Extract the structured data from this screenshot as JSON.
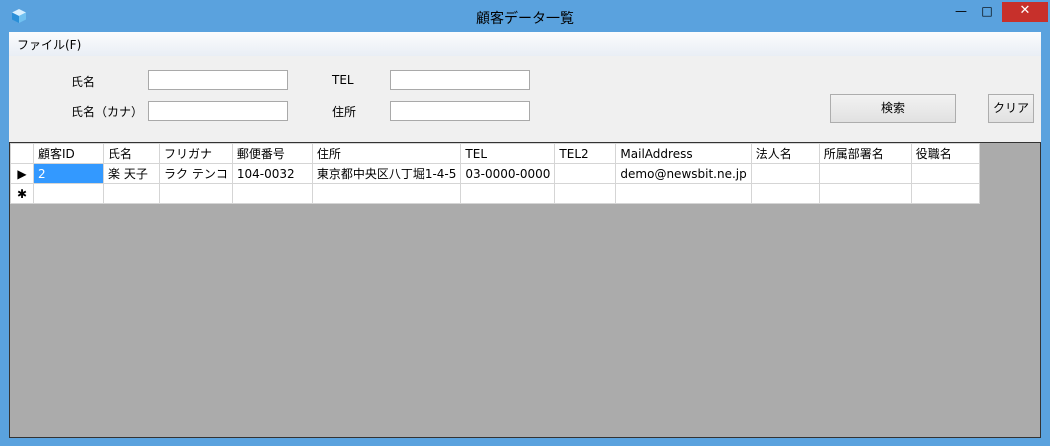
{
  "window": {
    "title": "顧客データ一覧",
    "min_glyph": "—",
    "max_glyph": "□",
    "close_glyph": "✕"
  },
  "menu": {
    "file": "ファイル(F)"
  },
  "search": {
    "name_label": "氏名",
    "kana_label": "氏名（カナ）",
    "tel_label": "TEL",
    "address_label": "住所",
    "name_value": "",
    "kana_value": "",
    "tel_value": "",
    "address_value": "",
    "search_button": "検索",
    "clear_button": "クリア"
  },
  "grid": {
    "columns": [
      "顧客ID",
      "氏名",
      "フリガナ",
      "郵便番号",
      "住所",
      "TEL",
      "TEL2",
      "MailAddress",
      "法人名",
      "所属部署名",
      "役職名"
    ],
    "rows": [
      [
        "2",
        "楽 天子",
        "ラク テンコ",
        "104-0032",
        "東京都中央区八丁堀1-4-5",
        "03-0000-0000",
        "",
        "demo@newsbit.ne.jp",
        "",
        "",
        ""
      ]
    ],
    "current_row_glyph": "▶",
    "new_row_glyph": "✱"
  },
  "colors": {
    "titlebar": "#5aa2de",
    "close": "#c7302b",
    "selection": "#3399ff",
    "grid_bg": "#ababab"
  }
}
